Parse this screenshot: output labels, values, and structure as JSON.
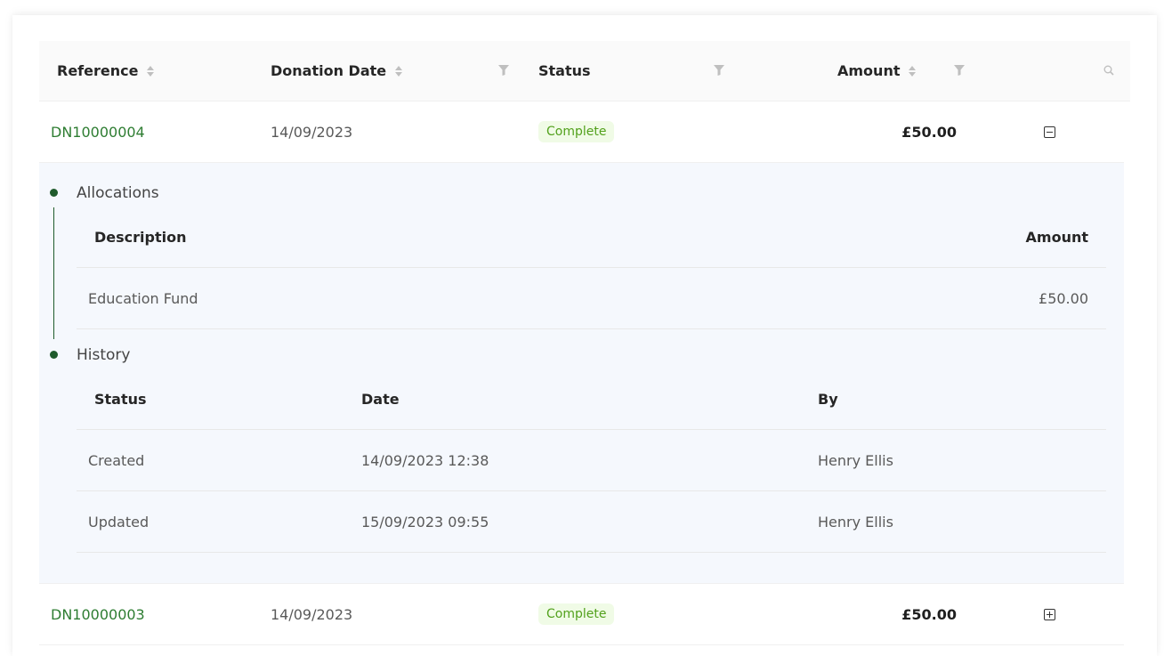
{
  "table": {
    "columns": {
      "reference": "Reference",
      "donation_date": "Donation Date",
      "status": "Status",
      "amount": "Amount"
    },
    "rows": [
      {
        "reference": "DN10000004",
        "donation_date": "14/09/2023",
        "status": "Complete",
        "amount": "£50.00",
        "expanded": true,
        "allocations": {
          "label": "Allocations",
          "columns": {
            "description": "Description",
            "amount": "Amount"
          },
          "rows": [
            {
              "description": "Education Fund",
              "amount": "£50.00"
            }
          ]
        },
        "history": {
          "label": "History",
          "columns": {
            "status": "Status",
            "date": "Date",
            "by": "By"
          },
          "rows": [
            {
              "status": "Created",
              "date": "14/09/2023 12:38",
              "by": "Henry Ellis"
            },
            {
              "status": "Updated",
              "date": "15/09/2023 09:55",
              "by": "Henry Ellis"
            }
          ]
        }
      },
      {
        "reference": "DN10000003",
        "donation_date": "14/09/2023",
        "status": "Complete",
        "amount": "£50.00",
        "expanded": false
      }
    ]
  },
  "colors": {
    "reference_link": "#2e7d32",
    "status_tag_bg": "#f0fbe6",
    "status_tag_text": "#52a11c",
    "expanded_bg": "#f5f8fd",
    "timeline": "#1f5b2c"
  },
  "icons": [
    "sort-icon",
    "filter-icon",
    "search-icon",
    "collapse-icon",
    "expand-icon"
  ]
}
